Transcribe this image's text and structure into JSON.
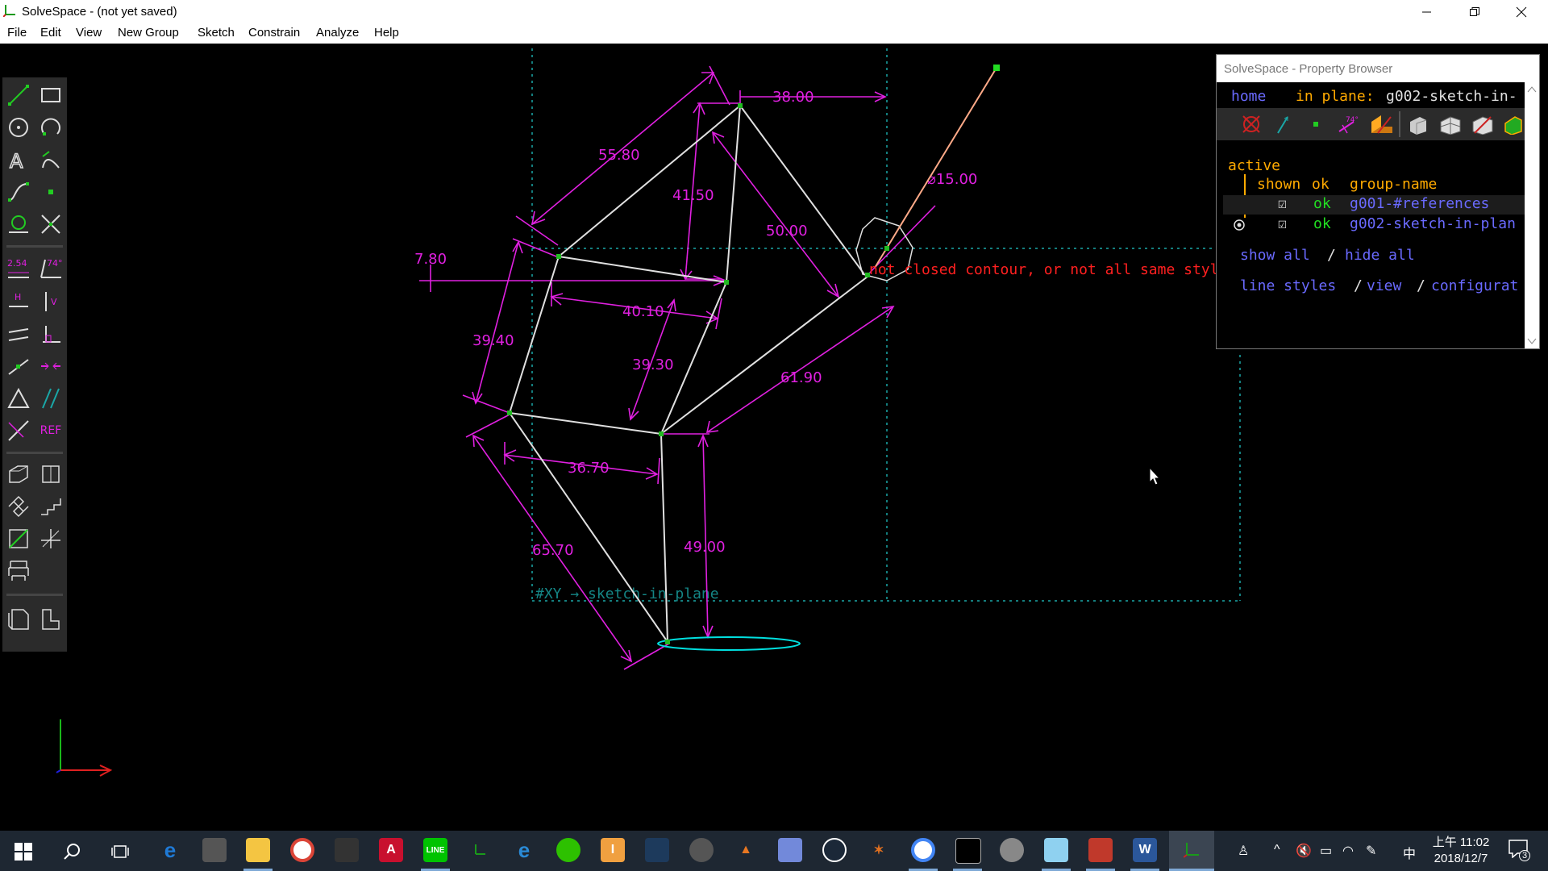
{
  "window": {
    "title": "SolveSpace - (not yet saved)",
    "minimize_icon": "minimize-icon",
    "maximize_icon": "restore-icon",
    "close_icon": "close-icon"
  },
  "menu": [
    "File",
    "Edit",
    "View",
    "New Group",
    "Sketch",
    "Constrain",
    "Analyze",
    "Help"
  ],
  "toolbar": {
    "tools": [
      "line-tool-icon",
      "rectangle-tool-icon",
      "circle-tool-icon",
      "arc-tool-icon",
      "text-tool-icon",
      "tangent-arc-tool-icon",
      "bezier-tool-icon",
      "point-tool-icon",
      "workplane-tool-icon",
      "split-curves-tool-icon",
      "distance-constraint-icon",
      "angle-constraint-icon",
      "horizontal-constraint-icon",
      "vertical-constraint-icon",
      "parallel-constraint-icon",
      "perpendicular-constraint-icon",
      "point-on-line-icon",
      "symmetric-constraint-icon",
      "equal-constraint-icon",
      "other-angle-icon",
      "construction-toggle-icon",
      "reference-toggle-icon",
      "extrude-icon",
      "lathe-icon",
      "step-rotating-icon",
      "step-translating-icon",
      "sketch-in-3d-icon",
      "sketch-in-plane-icon",
      "link-file-icon",
      "workplane-view-icon",
      "nearest-iso-icon"
    ],
    "distance_label": "2.54",
    "angle_label": "74°",
    "horizontal_label": "H",
    "vertical_label": "V",
    "ref_label": "REF"
  },
  "sketch": {
    "dimensions": [
      "38.00",
      "55.80",
      "41.50",
      "50.00",
      "⌀15.00",
      "7.80",
      "40.10",
      "39.40",
      "39.30",
      "61.90",
      "36.70",
      "65.70",
      "49.00"
    ],
    "error_message": "not closed contour, or not all same style!",
    "workplane_label": "#XY → sketch-in-plane"
  },
  "property_browser": {
    "title": "SolveSpace - Property Browser",
    "home_link": "home",
    "in_plane_label": "in plane:",
    "in_plane_value": "g002-sketch-in-",
    "active_label": "active",
    "columns": {
      "shown": "shown",
      "ok": "ok",
      "name": "group-name"
    },
    "groups": [
      {
        "shown": "☑",
        "ok": "ok",
        "name": "g001-#references",
        "active": false
      },
      {
        "shown": "☑",
        "ok": "ok",
        "name": "g002-sketch-in-plan",
        "active": true
      }
    ],
    "show_all": "show all",
    "hide_all": "hide all",
    "sep": "/",
    "line_styles": "line styles",
    "view": "view",
    "configuration": "configurat",
    "angle_icon_label": "74°"
  },
  "taskbar": {
    "apps": [
      "windows-start-icon",
      "search-icon",
      "task-view-icon",
      "edge-icon",
      "explorer-icon",
      "folder-icon",
      "chrome-icon",
      "calculator-icon",
      "autocad-icon",
      "line-icon",
      "solvespace-icon",
      "ie-icon",
      "wechat-icon",
      "ibooks-icon",
      "xcode-icon",
      "fusion-icon",
      "matlab-icon",
      "discord-icon",
      "steam-icon",
      "gecko-icon",
      "chrome2-icon",
      "terminal-icon",
      "wireframe-icon",
      "blue-app-icon",
      "red-app-icon",
      "word-icon",
      "solvespace-active-icon"
    ],
    "clock_time": "上午 11:02",
    "clock_date": "2018/12/7",
    "ime_label": "中",
    "notification_count": "3"
  },
  "colors": {
    "constraint": "#e020e0",
    "geometry": "#e0e0e0",
    "construction_grid": "#1aa7a7",
    "point": "#22bb22",
    "error": "#ff2020",
    "selection_cyan": "#00e0e0",
    "link_blue": "#6a6aff",
    "orange": "#ffaa00",
    "green_ok": "#22dd22"
  }
}
